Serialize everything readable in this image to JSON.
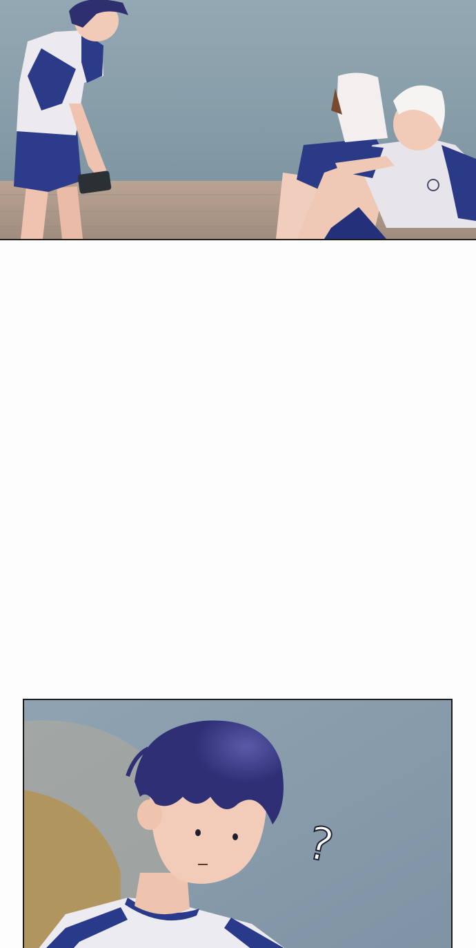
{
  "comic": {
    "panels": [
      {
        "scene": "gym-wall-three-students"
      },
      {
        "scene": "student-closeup-confused"
      }
    ],
    "effects": {
      "question_mark": "?"
    },
    "colors": {
      "wall": "#8ea3ae",
      "floor": "#b3a08f",
      "uniform_navy": "#2a3a86",
      "uniform_white": "#ece9ef",
      "hair": "#2e2f75",
      "skin": "#f2cbb8",
      "border": "#1b1b1b",
      "page": "#fdfdfd"
    }
  }
}
